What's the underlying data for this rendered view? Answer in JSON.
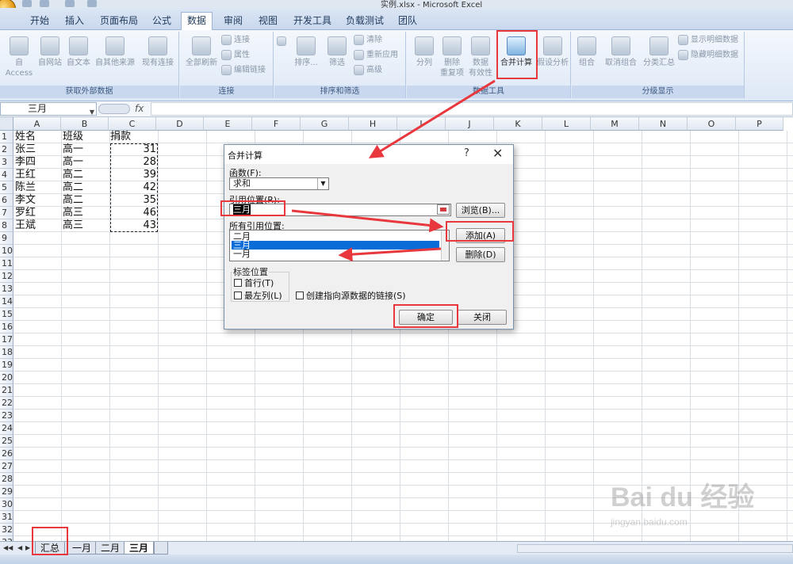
{
  "window": {
    "title": "实例.xlsx - Microsoft Excel"
  },
  "ribbon_tabs": [
    "开始",
    "插入",
    "页面布局",
    "公式",
    "数据",
    "审阅",
    "视图",
    "开发工具",
    "负载测试",
    "团队"
  ],
  "active_tab": "数据",
  "ribbon": {
    "ext_data": {
      "label": "获取外部数据",
      "access": "自 Access",
      "web": "自网站",
      "text": "自文本",
      "other": "自其他来源",
      "existing": "现有连接"
    },
    "connections": {
      "label": "连接",
      "refresh_all": "全部刷新",
      "connections": "连接",
      "properties": "属性",
      "edit_links": "编辑链接"
    },
    "sort_filter": {
      "label": "排序和筛选",
      "sort": "排序...",
      "filter": "筛选",
      "clear": "清除",
      "reapply": "重新应用",
      "advanced": "高级"
    },
    "data_tools": {
      "label": "数据工具",
      "text_to_cols": "分列",
      "remove_dup": "删除",
      "remove_dup_2": "重复项",
      "validation": "数据",
      "validation_2": "有效性",
      "consolidate": "合并计算",
      "what_if": "假设分析"
    },
    "outline": {
      "label": "分级显示",
      "group": "组合",
      "ungroup": "取消组合",
      "subtotal": "分类汇总",
      "show_detail": "显示明细数据",
      "hide_detail": "隐藏明细数据"
    }
  },
  "formula_bar": {
    "name_box": "三月",
    "fx": "fx"
  },
  "columns": [
    "A",
    "B",
    "C",
    "D",
    "E",
    "F",
    "G",
    "H",
    "I",
    "J",
    "K",
    "L",
    "M",
    "N",
    "O",
    "P"
  ],
  "rows": [
    "1",
    "2",
    "3",
    "4",
    "5",
    "6",
    "7",
    "8",
    "9",
    "10",
    "11",
    "12",
    "13",
    "14",
    "15",
    "16",
    "17",
    "18",
    "19",
    "20",
    "21",
    "22",
    "23",
    "24",
    "25",
    "26",
    "27",
    "28",
    "29",
    "30",
    "31",
    "32",
    "33"
  ],
  "sheet": {
    "headers": [
      "姓名",
      "班级",
      "捐款"
    ],
    "records": [
      [
        "张三",
        "高一",
        "31"
      ],
      [
        "李四",
        "高一",
        "28"
      ],
      [
        "王红",
        "高二",
        "39"
      ],
      [
        "陈兰",
        "高二",
        "42"
      ],
      [
        "李文",
        "高二",
        "35"
      ],
      [
        "罗红",
        "高三",
        "46"
      ],
      [
        "王斌",
        "高三",
        "43"
      ]
    ]
  },
  "sheet_tabs": [
    "汇总",
    "一月",
    "二月",
    "三月"
  ],
  "active_sheet": "三月",
  "dialog": {
    "title": "合并计算",
    "help": "?",
    "close": "✕",
    "function_label": "函数(F):",
    "function_value": "求和",
    "reference_label": "引用位置(R):",
    "reference_value": "三月",
    "browse_button": "浏览(B)...",
    "all_refs_label": "所有引用位置:",
    "all_refs": [
      "二月",
      "三月",
      "一月"
    ],
    "selected_ref": "三月",
    "add_button": "添加(A)",
    "delete_button": "删除(D)",
    "labels_group": "标签位置",
    "first_row": "首行(T)",
    "left_column": "最左列(L)",
    "create_links": "创建指向源数据的链接(S)",
    "ok_button": "确定",
    "close_button": "关闭"
  },
  "watermark": {
    "brand": "Bai du 经验",
    "url": "jingyan.baidu.com"
  },
  "colors": {
    "annotation": "#e8383d",
    "selection": "#0a6cd6",
    "ribbon_bg": "#dde8f6"
  }
}
